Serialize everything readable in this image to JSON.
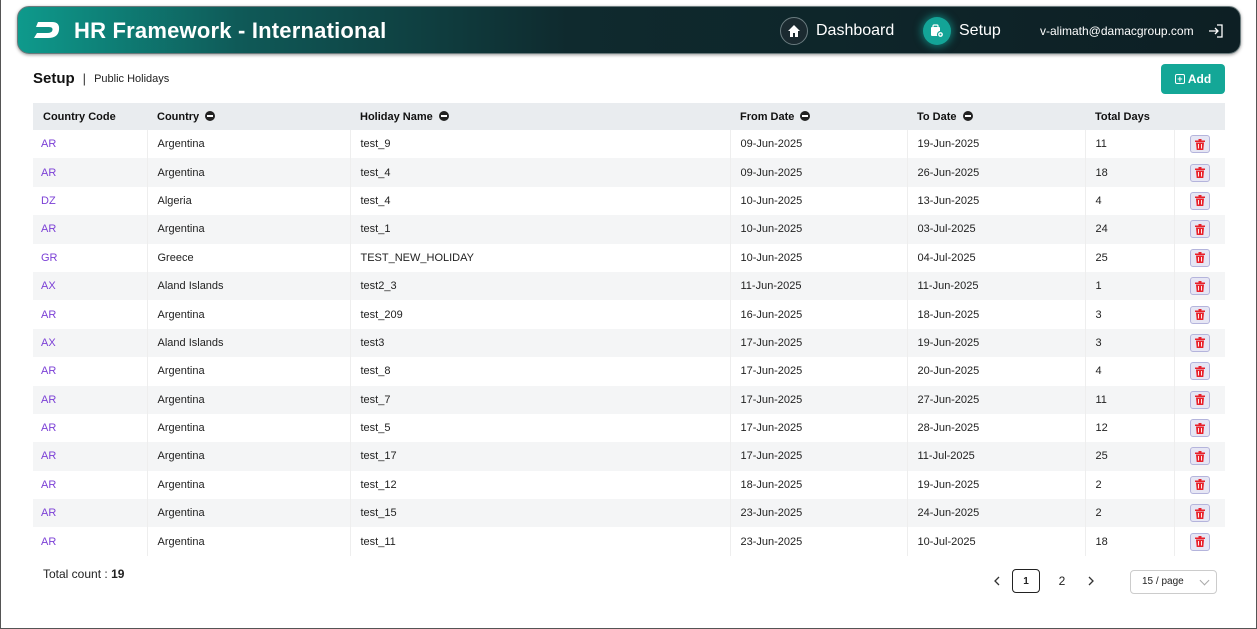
{
  "header": {
    "app_title": "HR Framework - International",
    "nav": {
      "dashboard_label": "Dashboard",
      "setup_label": "Setup"
    },
    "user_email": "v-alimath@damacgroup.com"
  },
  "breadcrumb": {
    "main": "Setup",
    "separator": "|",
    "sub": "Public Holidays"
  },
  "add_button": {
    "label": "Add"
  },
  "table": {
    "columns": [
      "Country Code",
      "Country",
      "Holiday Name",
      "From Date",
      "To Date",
      "Total Days"
    ],
    "rows": [
      [
        "AR",
        "Argentina",
        "test_9",
        "09-Jun-2025",
        "19-Jun-2025",
        "11"
      ],
      [
        "AR",
        "Argentina",
        "test_4",
        "09-Jun-2025",
        "26-Jun-2025",
        "18"
      ],
      [
        "DZ",
        "Algeria",
        "test_4",
        "10-Jun-2025",
        "13-Jun-2025",
        "4"
      ],
      [
        "AR",
        "Argentina",
        "test_1",
        "10-Jun-2025",
        "03-Jul-2025",
        "24"
      ],
      [
        "GR",
        "Greece",
        "TEST_NEW_HOLIDAY",
        "10-Jun-2025",
        "04-Jul-2025",
        "25"
      ],
      [
        "AX",
        "Aland Islands",
        "test2_3",
        "11-Jun-2025",
        "11-Jun-2025",
        "1"
      ],
      [
        "AR",
        "Argentina",
        "test_209",
        "16-Jun-2025",
        "18-Jun-2025",
        "3"
      ],
      [
        "AX",
        "Aland Islands",
        "test3",
        "17-Jun-2025",
        "19-Jun-2025",
        "3"
      ],
      [
        "AR",
        "Argentina",
        "test_8",
        "17-Jun-2025",
        "20-Jun-2025",
        "4"
      ],
      [
        "AR",
        "Argentina",
        "test_7",
        "17-Jun-2025",
        "27-Jun-2025",
        "11"
      ],
      [
        "AR",
        "Argentina",
        "test_5",
        "17-Jun-2025",
        "28-Jun-2025",
        "12"
      ],
      [
        "AR",
        "Argentina",
        "test_17",
        "17-Jun-2025",
        "11-Jul-2025",
        "25"
      ],
      [
        "AR",
        "Argentina",
        "test_12",
        "18-Jun-2025",
        "19-Jun-2025",
        "2"
      ],
      [
        "AR",
        "Argentina",
        "test_15",
        "23-Jun-2025",
        "24-Jun-2025",
        "2"
      ],
      [
        "AR",
        "Argentina",
        "test_11",
        "23-Jun-2025",
        "10-Jul-2025",
        "18"
      ]
    ]
  },
  "footer": {
    "total_label": "Total count :",
    "total_value": "19",
    "pages": [
      "1",
      "2"
    ],
    "page_size": "15 / page"
  },
  "colors": {
    "accent": "#14a797",
    "code_link": "#7b3fd6",
    "delete": "#e8202a"
  }
}
